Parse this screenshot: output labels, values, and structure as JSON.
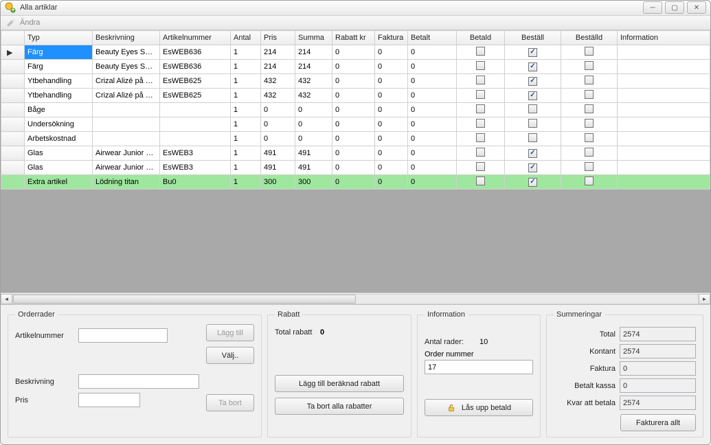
{
  "window": {
    "title": "Alla artiklar"
  },
  "toolbar": {
    "edit_label": "Ändra"
  },
  "grid": {
    "headers": {
      "typ": "Typ",
      "beskrivning": "Beskrivning",
      "artikelnummer": "Artikelnummer",
      "antal": "Antal",
      "pris": "Pris",
      "summa": "Summa",
      "rabatt": "Rabatt kr",
      "faktura": "Faktura",
      "betalt": "Betalt",
      "betald": "Betald",
      "bestall": "Beställ",
      "bestalld": "Beställd",
      "information": "Information"
    },
    "rows": [
      {
        "marker": "▶",
        "selected": true,
        "typ": "Färg",
        "beskrivning": "Beauty Eyes Safir...",
        "artikelnummer": "EsWEB636",
        "antal": "1",
        "pris": "214",
        "summa": "214",
        "rabatt": "0",
        "faktura": "0",
        "betalt": "0",
        "betald": false,
        "bestall": true,
        "bestalld": false
      },
      {
        "marker": "",
        "typ": "Färg",
        "beskrivning": "Beauty Eyes Safir...",
        "artikelnummer": "EsWEB636",
        "antal": "1",
        "pris": "214",
        "summa": "214",
        "rabatt": "0",
        "faktura": "0",
        "betalt": "0",
        "betald": false,
        "bestall": true,
        "bestalld": false
      },
      {
        "marker": "",
        "typ": "Ytbehandling",
        "beskrivning": "Crizal Alizé på Or ...",
        "artikelnummer": "EsWEB625",
        "antal": "1",
        "pris": "432",
        "summa": "432",
        "rabatt": "0",
        "faktura": "0",
        "betalt": "0",
        "betald": false,
        "bestall": true,
        "bestalld": false
      },
      {
        "marker": "",
        "typ": "Ytbehandling",
        "beskrivning": "Crizal Alizé på Or ...",
        "artikelnummer": "EsWEB625",
        "antal": "1",
        "pris": "432",
        "summa": "432",
        "rabatt": "0",
        "faktura": "0",
        "betalt": "0",
        "betald": false,
        "bestall": true,
        "bestalld": false
      },
      {
        "marker": "",
        "typ": "Båge",
        "beskrivning": "",
        "artikelnummer": "",
        "antal": "1",
        "pris": "0",
        "summa": "0",
        "rabatt": "0",
        "faktura": "0",
        "betalt": "0",
        "betald": false,
        "bestall": false,
        "bestalld": false
      },
      {
        "marker": "",
        "typ": "Undersökning",
        "beskrivning": "",
        "artikelnummer": "",
        "antal": "1",
        "pris": "0",
        "summa": "0",
        "rabatt": "0",
        "faktura": "0",
        "betalt": "0",
        "betald": false,
        "bestall": false,
        "bestalld": false
      },
      {
        "marker": "",
        "typ": "Arbetskostnad",
        "beskrivning": "",
        "artikelnummer": "",
        "antal": "1",
        "pris": "0",
        "summa": "0",
        "rabatt": "0",
        "faktura": "0",
        "betalt": "0",
        "betald": false,
        "bestall": false,
        "bestalld": false
      },
      {
        "marker": "",
        "typ": "Glas",
        "beskrivning": "Airwear Junior Rx...",
        "artikelnummer": "EsWEB3",
        "antal": "1",
        "pris": "491",
        "summa": "491",
        "rabatt": "0",
        "faktura": "0",
        "betalt": "0",
        "betald": false,
        "bestall": true,
        "bestalld": false
      },
      {
        "marker": "",
        "typ": "Glas",
        "beskrivning": "Airwear Junior Rx...",
        "artikelnummer": "EsWEB3",
        "antal": "1",
        "pris": "491",
        "summa": "491",
        "rabatt": "0",
        "faktura": "0",
        "betalt": "0",
        "betald": false,
        "bestall": true,
        "bestalld": false
      },
      {
        "marker": "",
        "green": true,
        "typ": "Extra artikel",
        "beskrivning": "Lödning titan",
        "artikelnummer": "Bu0",
        "antal": "1",
        "pris": "300",
        "summa": "300",
        "rabatt": "0",
        "faktura": "0",
        "betalt": "0",
        "betald": false,
        "bestall": true,
        "bestalld": false
      }
    ]
  },
  "orderrader": {
    "legend": "Orderrader",
    "artikelnummer_label": "Artikelnummer",
    "beskrivning_label": "Beskrivning",
    "pris_label": "Pris",
    "laggtill_label": "Lägg till",
    "valj_label": "Välj..",
    "tabort_label": "Ta bort"
  },
  "rabatt": {
    "legend": "Rabatt",
    "total_rabatt_label": "Total rabatt",
    "total_rabatt_value": "0",
    "lagg_till_beraknad_label": "Lägg till beräknad rabatt",
    "tabort_alla_label": "Ta bort alla rabatter"
  },
  "information": {
    "legend": "Information",
    "antal_rader_label": "Antal rader:",
    "antal_rader_value": "10",
    "order_nummer_label": "Order nummer",
    "order_nummer_value": "17",
    "las_upp_label": "Lås upp betald"
  },
  "summeringar": {
    "legend": "Summeringar",
    "total_label": "Total",
    "total_value": "2574",
    "kontant_label": "Kontant",
    "kontant_value": "2574",
    "faktura_label": "Faktura",
    "faktura_value": "0",
    "betalt_kassa_label": "Betalt kassa",
    "betalt_kassa_value": "0",
    "kvar_label": "Kvar att betala",
    "kvar_value": "2574",
    "fakturera_label": "Fakturera allt"
  }
}
